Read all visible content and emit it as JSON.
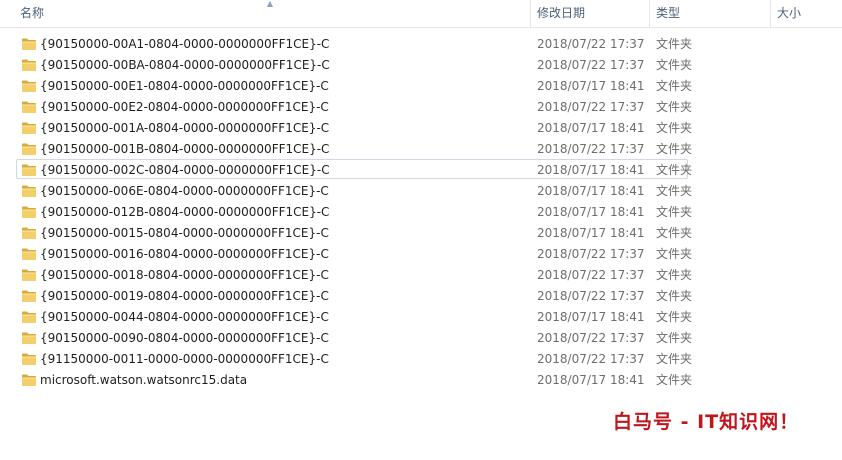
{
  "columns": {
    "name": "名称",
    "modified": "修改日期",
    "type": "类型",
    "size": "大小"
  },
  "files": [
    {
      "name": "{90150000-00A1-0804-0000-0000000FF1CE}-C",
      "date": "2018/07/22 17:37",
      "type": "文件夹",
      "icon": "folder-icon"
    },
    {
      "name": "{90150000-00BA-0804-0000-0000000FF1CE}-C",
      "date": "2018/07/22 17:37",
      "type": "文件夹",
      "icon": "folder-icon"
    },
    {
      "name": "{90150000-00E1-0804-0000-0000000FF1CE}-C",
      "date": "2018/07/17 18:41",
      "type": "文件夹",
      "icon": "folder-icon"
    },
    {
      "name": "{90150000-00E2-0804-0000-0000000FF1CE}-C",
      "date": "2018/07/22 17:37",
      "type": "文件夹",
      "icon": "folder-icon"
    },
    {
      "name": "{90150000-001A-0804-0000-0000000FF1CE}-C",
      "date": "2018/07/17 18:41",
      "type": "文件夹",
      "icon": "folder-icon"
    },
    {
      "name": "{90150000-001B-0804-0000-0000000FF1CE}-C",
      "date": "2018/07/22 17:37",
      "type": "文件夹",
      "icon": "folder-icon"
    },
    {
      "name": "{90150000-002C-0804-0000-0000000FF1CE}-C",
      "date": "2018/07/17 18:41",
      "type": "文件夹",
      "icon": "folder-icon"
    },
    {
      "name": "{90150000-006E-0804-0000-0000000FF1CE}-C",
      "date": "2018/07/17 18:41",
      "type": "文件夹",
      "icon": "folder-icon"
    },
    {
      "name": "{90150000-012B-0804-0000-0000000FF1CE}-C",
      "date": "2018/07/17 18:41",
      "type": "文件夹",
      "icon": "folder-icon"
    },
    {
      "name": "{90150000-0015-0804-0000-0000000FF1CE}-C",
      "date": "2018/07/17 18:41",
      "type": "文件夹",
      "icon": "folder-icon"
    },
    {
      "name": "{90150000-0016-0804-0000-0000000FF1CE}-C",
      "date": "2018/07/22 17:37",
      "type": "文件夹",
      "icon": "folder-icon"
    },
    {
      "name": "{90150000-0018-0804-0000-0000000FF1CE}-C",
      "date": "2018/07/22 17:37",
      "type": "文件夹",
      "icon": "folder-icon"
    },
    {
      "name": "{90150000-0019-0804-0000-0000000FF1CE}-C",
      "date": "2018/07/22 17:37",
      "type": "文件夹",
      "icon": "folder-icon"
    },
    {
      "name": "{90150000-0044-0804-0000-0000000FF1CE}-C",
      "date": "2018/07/17 18:41",
      "type": "文件夹",
      "icon": "folder-icon"
    },
    {
      "name": "{90150000-0090-0804-0000-0000000FF1CE}-C",
      "date": "2018/07/22 17:37",
      "type": "文件夹",
      "icon": "folder-icon"
    },
    {
      "name": "{91150000-0011-0000-0000-0000000FF1CE}-C",
      "date": "2018/07/22 17:37",
      "type": "文件夹",
      "icon": "folder-icon"
    },
    {
      "name": "microsoft.watson.watsonrc15.data",
      "date": "2018/07/17 18:41",
      "type": "文件夹",
      "icon": "folder-icon"
    }
  ],
  "focused_row": 6,
  "watermark": "白马号 - IT知识网！",
  "colors": {
    "header_text": "#4c607a",
    "folder": "#e8c25a",
    "watermark": "#c0151b"
  }
}
